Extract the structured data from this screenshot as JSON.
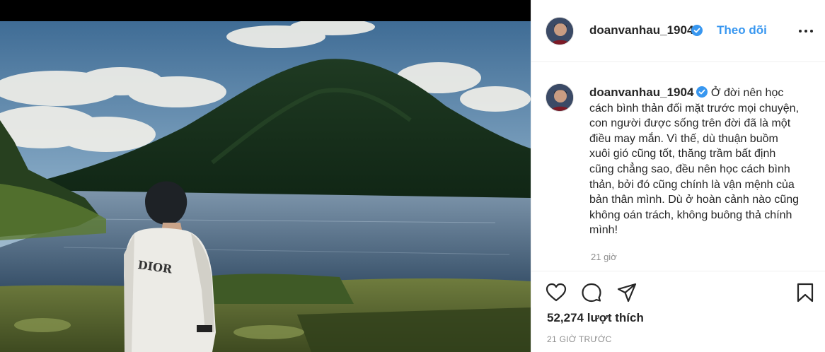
{
  "post": {
    "photo_alt": "",
    "author": {
      "username": "doanvanhau_1904",
      "verified": true
    },
    "follow_label": "Theo dõi",
    "caption": "Ở đời nên học cách bình thản đối mặt trước mọi chuyện, con người được sống trên đời đã là một điều may mắn. Vì thế, dù thuận buồm xuôi gió cũng tốt, thăng trầm bất định cũng chẳng sao, đều nên học cách bình thản, bởi đó cũng chính là vận mệnh của bản thân mình. Dù ở hoàn cảnh nào cũng không oán trách, không buông thả chính mình!",
    "caption_time": "21 giờ",
    "likes": "52,274 lượt thích",
    "posted_ago": "21 GIỜ TRƯỚC"
  },
  "icons": {
    "verified": "verified-badge-icon",
    "more": "more-options-icon",
    "like": "heart-icon",
    "comment": "comment-icon",
    "share": "paper-plane-icon",
    "save": "bookmark-icon"
  },
  "colors": {
    "link": "#3897f0",
    "verified": "#3897f0",
    "muted": "#8e8e8e",
    "text": "#262626"
  }
}
